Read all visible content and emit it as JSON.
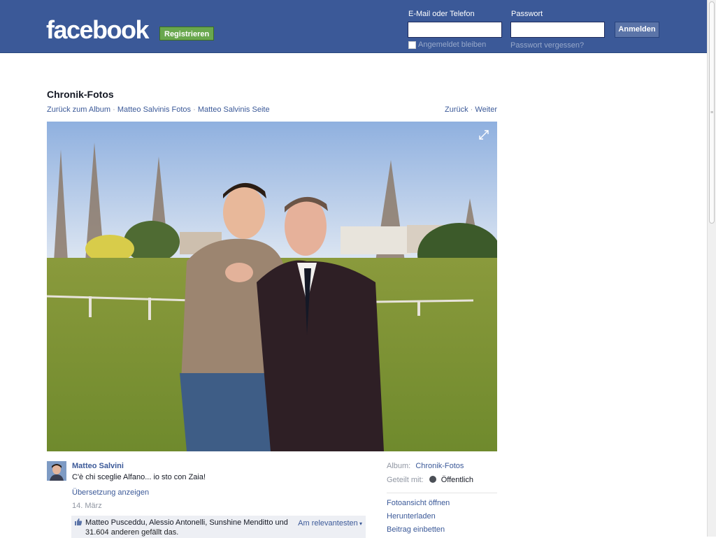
{
  "header": {
    "logo": "facebook",
    "register_label": "Registrieren",
    "email_label": "E-Mail oder Telefon",
    "password_label": "Passwort",
    "email_value": "",
    "password_value": "",
    "login_label": "Anmelden",
    "remember_label": "Angemeldet bleiben",
    "forgot_label": "Passwort vergessen?"
  },
  "page": {
    "title": "Chronik-Fotos",
    "breadcrumbs": [
      "Zurück zum Album",
      "Matteo Salvinis Fotos",
      "Matteo Salvinis Seite"
    ],
    "separator": "·",
    "nav_back": "Zurück",
    "nav_next": "Weiter"
  },
  "post": {
    "author": "Matteo Salvini",
    "caption": "C'è chi sceglie Alfano... io sto con Zaia!",
    "translate": "Übersetzung anzeigen",
    "date": "14. März",
    "likes_line1": "Matteo Pusceddu, Alessio Antonelli, Sunshine Menditto und",
    "likes_line2": "31.604 anderen gefällt das.",
    "sort_label": "Am relevantesten"
  },
  "sidebar": {
    "album_label": "Album:",
    "album_value": "Chronik-Fotos",
    "shared_label": "Geteilt mit:",
    "shared_value": "Öffentlich",
    "actions": [
      "Fotoansicht öffnen",
      "Herunterladen",
      "Beitrag einbetten"
    ]
  },
  "colors": {
    "brand_blue": "#3b5998",
    "register_green": "#69a74e"
  },
  "icons": [
    "expand-icon",
    "like-thumb-icon",
    "globe-icon",
    "chevron-down-icon"
  ]
}
